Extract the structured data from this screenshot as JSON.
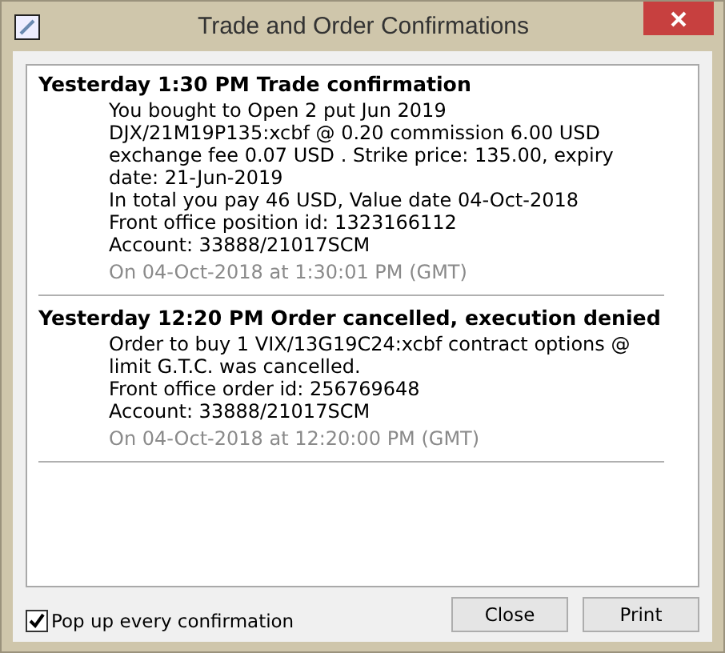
{
  "window": {
    "title": "Trade and Order Confirmations"
  },
  "messages": [
    {
      "heading": "Yesterday 1:30 PM Trade confirmation",
      "lines": [
        "You bought to Open 2 put Jun 2019",
        "DJX/21M19P135:xcbf @ 0.20 commission 6.00 USD",
        "exchange fee 0.07 USD . Strike price: 135.00, expiry",
        "date: 21-Jun-2019",
        "In total you pay 46 USD, Value date 04-Oct-2018",
        "Front office position id: 1323166112",
        "Account: 33888/21017SCM"
      ],
      "timestamp": "On 04-Oct-2018 at 1:30:01 PM (GMT)"
    },
    {
      "heading": "Yesterday 12:20 PM Order cancelled, execution denied",
      "lines": [
        "Order to buy 1 VIX/13G19C24:xcbf contract options @",
        "limit G.T.C. was cancelled.",
        "Front office order id: 256769648",
        "Account: 33888/21017SCM"
      ],
      "timestamp": "On 04-Oct-2018 at 12:20:00 PM (GMT)"
    }
  ],
  "popup_checkbox": {
    "label": "Pop up every confirmation",
    "checked": true
  },
  "buttons": [
    "Close",
    "Print"
  ]
}
